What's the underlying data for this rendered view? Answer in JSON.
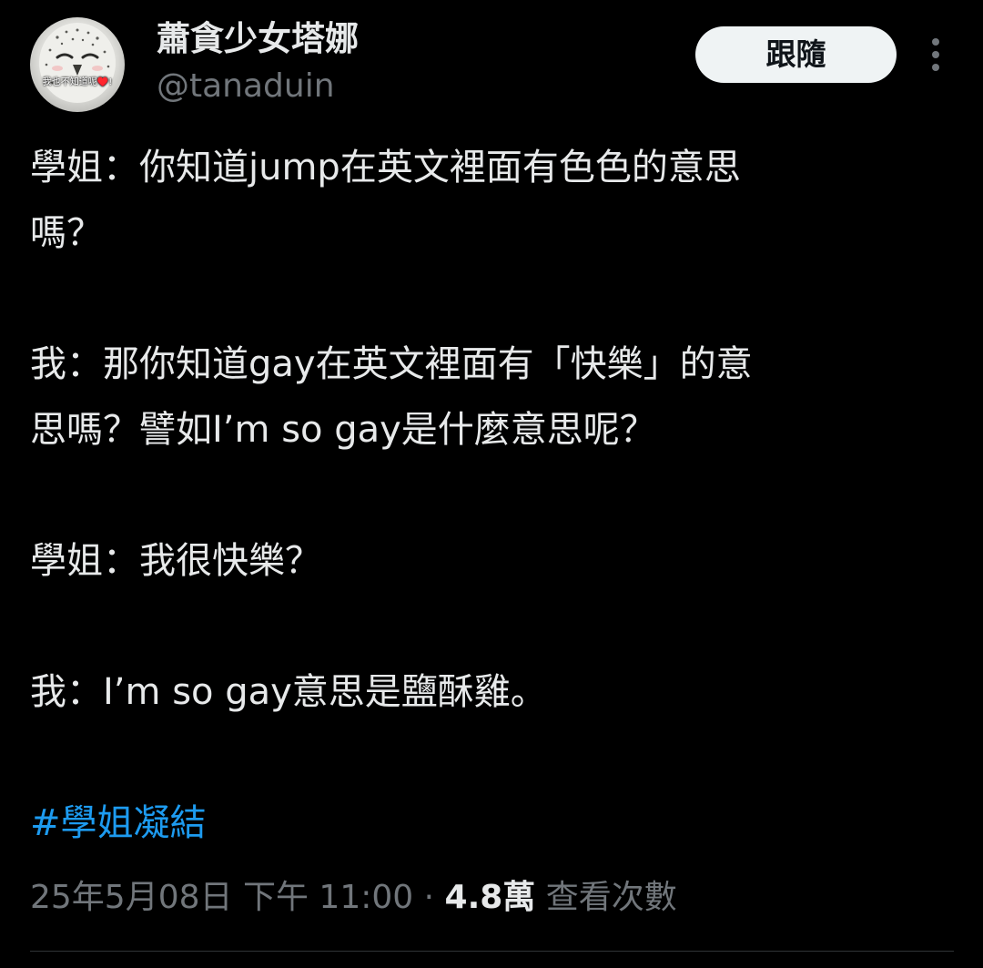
{
  "author": {
    "display_name": "蕭貪少女塔娜",
    "handle": "@tanaduin",
    "avatar_caption": "我也不知道呢♥️!"
  },
  "actions": {
    "follow_label": "跟隨",
    "more_icon": "more-vertical-icon"
  },
  "tweet": {
    "lines": [
      "學姐：你知道jump在英文裡面有色色的意思",
      "嗎？",
      "",
      "我：那你知道gay在英文裡面有「快樂」的意",
      "思嗎？譬如I’m so gay是什麼意思呢？",
      "",
      "學姐：我很快樂？",
      "",
      "我：I’m so gay意思是鹽酥雞。"
    ],
    "hashtag": "#學姐凝結"
  },
  "meta": {
    "timestamp": "25年5月08日 下午 11:00",
    "separator": "·",
    "views_count": "4.8萬",
    "views_label": "查看次數"
  },
  "colors": {
    "background": "#000000",
    "text": "#e7e9ea",
    "secondary": "#71767b",
    "link": "#1d9bf0",
    "button_bg": "#eff3f4"
  }
}
